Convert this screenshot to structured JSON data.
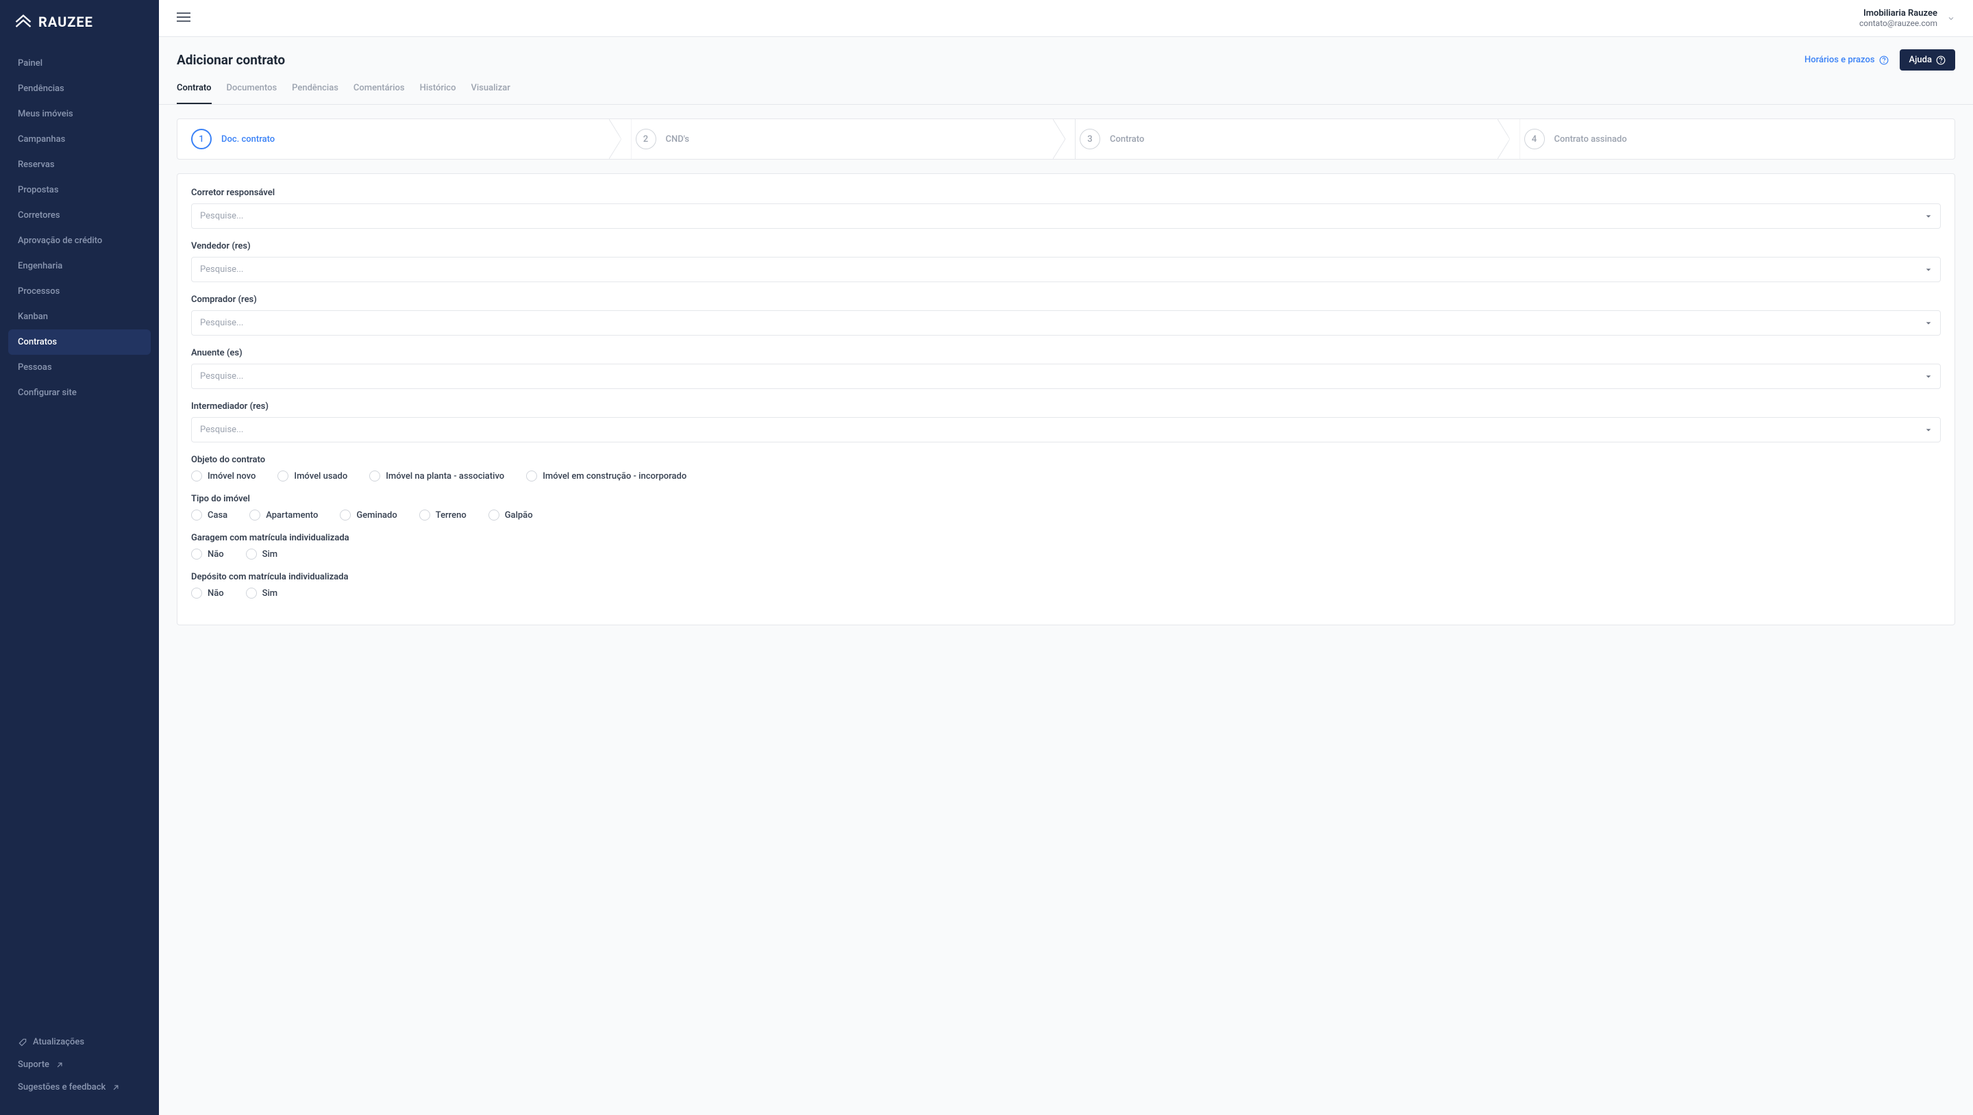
{
  "brand": "RAUZEE",
  "sidebar": {
    "items": [
      {
        "label": "Painel"
      },
      {
        "label": "Pendências"
      },
      {
        "label": "Meus imóveis"
      },
      {
        "label": "Campanhas"
      },
      {
        "label": "Reservas"
      },
      {
        "label": "Propostas"
      },
      {
        "label": "Corretores"
      },
      {
        "label": "Aprovação de crédito"
      },
      {
        "label": "Engenharia"
      },
      {
        "label": "Processos"
      },
      {
        "label": "Kanban"
      },
      {
        "label": "Contratos"
      },
      {
        "label": "Pessoas"
      },
      {
        "label": "Configurar site"
      }
    ],
    "bottom": [
      {
        "label": "Atualizações"
      },
      {
        "label": "Suporte"
      },
      {
        "label": "Sugestões e feedback"
      }
    ]
  },
  "user": {
    "name": "Imobiliaria Rauzee",
    "email": "contato@rauzee.com"
  },
  "page": {
    "title": "Adicionar contrato",
    "schedule_link": "Horários e prazos",
    "help_label": "Ajuda"
  },
  "tabs": [
    {
      "label": "Contrato",
      "active": true
    },
    {
      "label": "Documentos"
    },
    {
      "label": "Pendências"
    },
    {
      "label": "Comentários"
    },
    {
      "label": "Histórico"
    },
    {
      "label": "Visualizar"
    }
  ],
  "steps": [
    {
      "num": "1",
      "label": "Doc. contrato",
      "active": true
    },
    {
      "num": "2",
      "label": "CND's"
    },
    {
      "num": "3",
      "label": "Contrato"
    },
    {
      "num": "4",
      "label": "Contrato assinado"
    }
  ],
  "form": {
    "search_placeholder": "Pesquise...",
    "fields": [
      {
        "label": "Corretor responsável",
        "type": "select"
      },
      {
        "label": "Vendedor (res)",
        "type": "select"
      },
      {
        "label": "Comprador (res)",
        "type": "select"
      },
      {
        "label": "Anuente (es)",
        "type": "select"
      },
      {
        "label": "Intermediador (res)",
        "type": "select"
      }
    ],
    "radio_groups": [
      {
        "label": "Objeto do contrato",
        "options": [
          "Imóvel novo",
          "Imóvel usado",
          "Imóvel na planta - associativo",
          "Imóvel em construção - incorporado"
        ]
      },
      {
        "label": "Tipo do imóvel",
        "options": [
          "Casa",
          "Apartamento",
          "Geminado",
          "Terreno",
          "Galpão"
        ]
      },
      {
        "label": "Garagem com matrícula individualizada",
        "options": [
          "Não",
          "Sim"
        ]
      },
      {
        "label": "Depósito com matrícula individualizada",
        "options": [
          "Não",
          "Sim"
        ]
      }
    ]
  }
}
